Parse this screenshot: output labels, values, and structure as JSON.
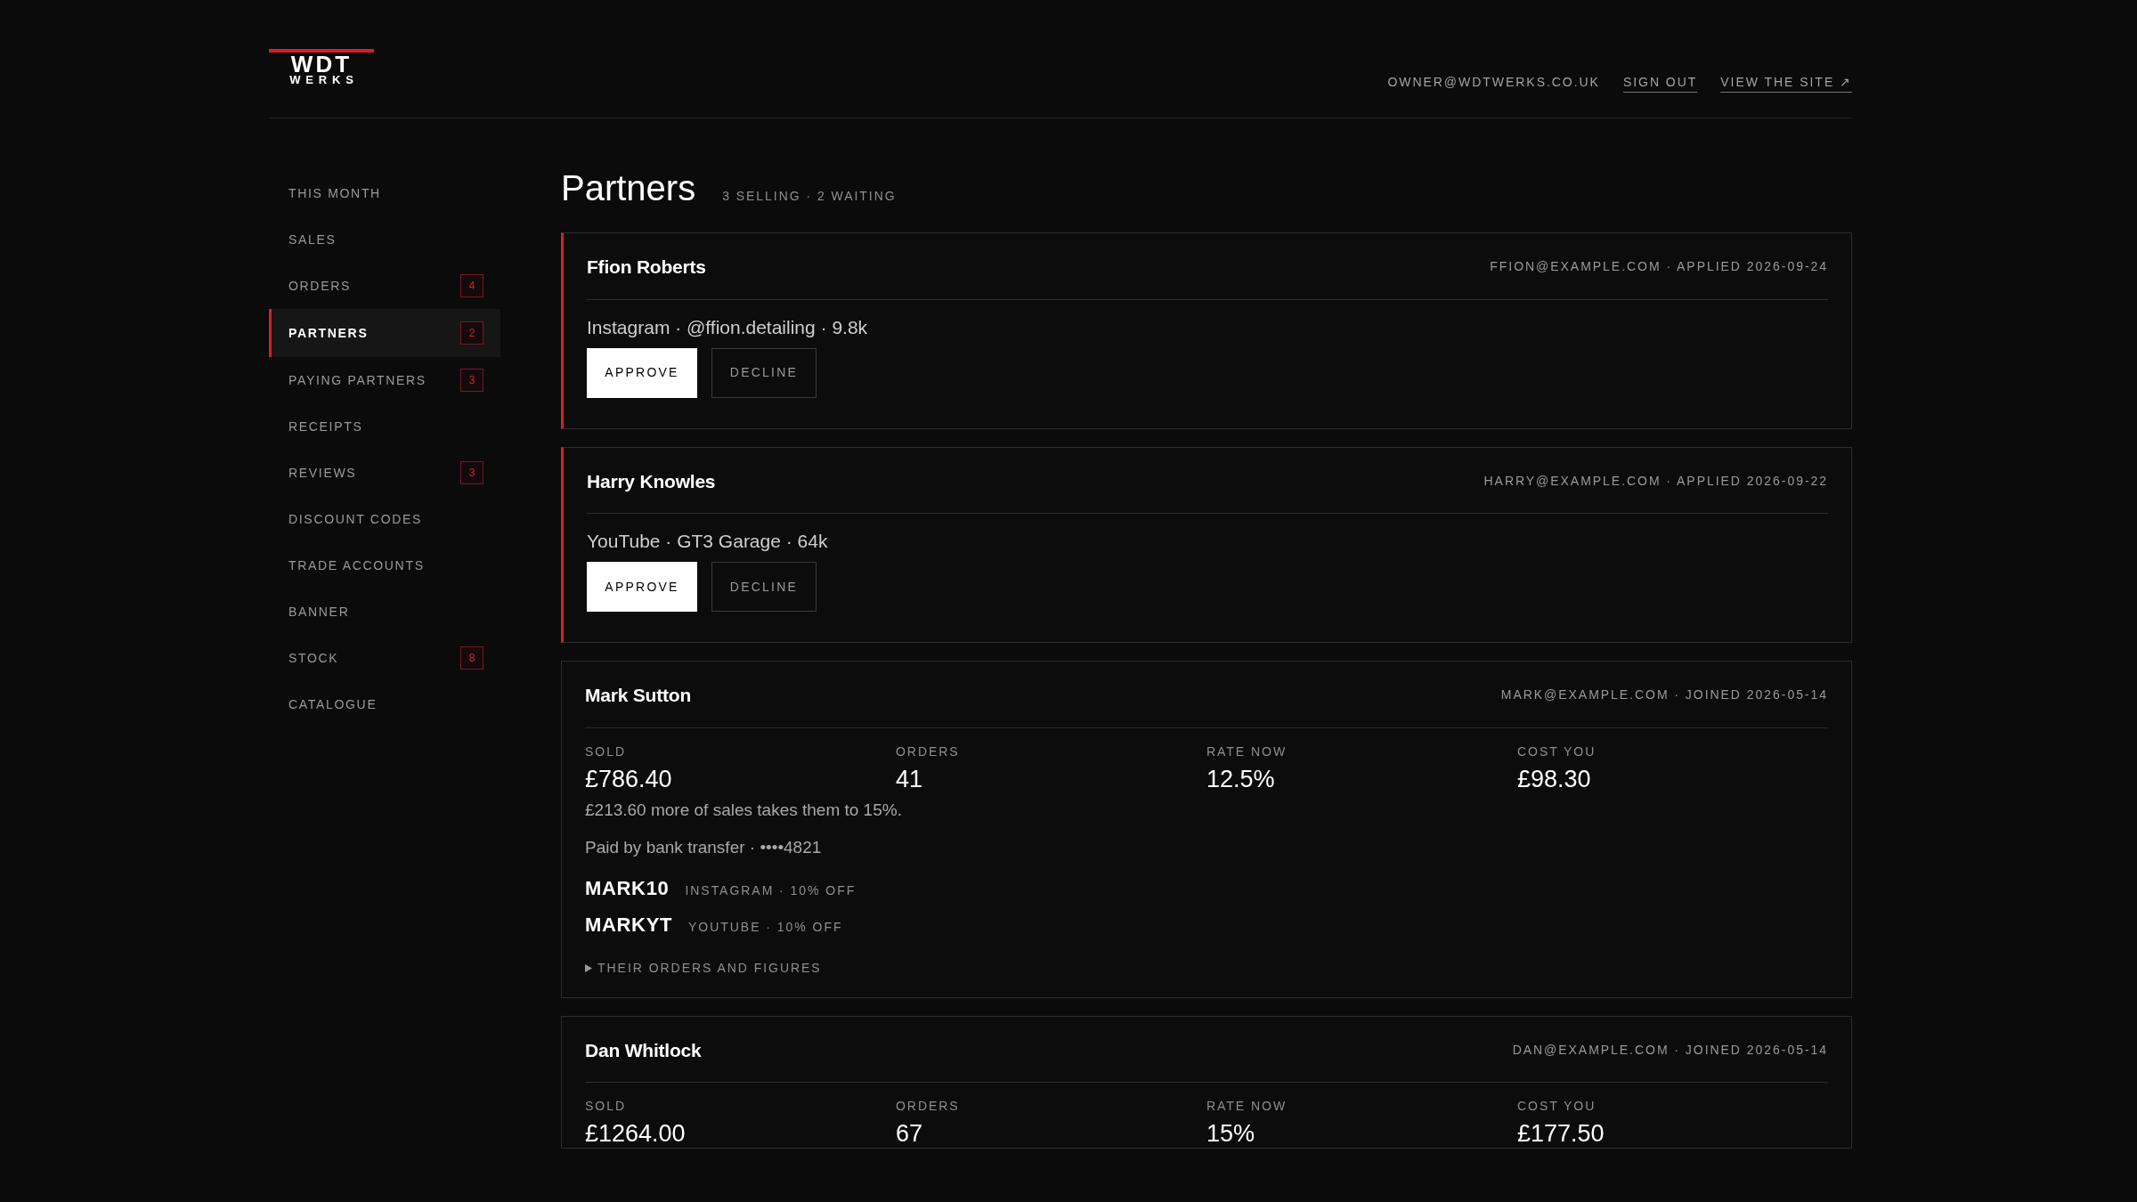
{
  "header": {
    "logo": {
      "top": "WDT",
      "bottom": "WERKS"
    },
    "account": "OWNER@WDTWERKS.CO.UK",
    "links": [
      {
        "label": "SIGN OUT"
      },
      {
        "label": "VIEW THE SITE ↗"
      }
    ]
  },
  "sidebar": {
    "items": [
      {
        "label": "THIS MONTH",
        "selected": false
      },
      {
        "label": "SALES",
        "selected": false
      },
      {
        "label": "ORDERS",
        "badge": "4",
        "selected": false
      },
      {
        "label": "PARTNERS",
        "badge": "2",
        "selected": true
      },
      {
        "label": "PAYING PARTNERS",
        "badge": "3",
        "selected": false
      },
      {
        "label": "RECEIPTS",
        "selected": false
      },
      {
        "label": "REVIEWS",
        "badge": "3",
        "selected": false
      },
      {
        "label": "DISCOUNT CODES",
        "selected": false
      },
      {
        "label": "TRADE ACCOUNTS",
        "selected": false
      },
      {
        "label": "BANNER",
        "selected": false
      },
      {
        "label": "STOCK",
        "badge": "8",
        "selected": false
      },
      {
        "label": "CATALOGUE",
        "selected": false
      }
    ]
  },
  "page": {
    "title": "Partners",
    "summary": "3 SELLING · 2 WAITING"
  },
  "partners": [
    {
      "kind": "applicant",
      "name": "Ffion Roberts",
      "meta": "FFION@EXAMPLE.COM · APPLIED 2026-09-24",
      "detail": "Instagram · @ffion.detailing · 9.8k",
      "buttons": [
        "APPROVE",
        "DECLINE"
      ]
    },
    {
      "kind": "applicant",
      "name": "Harry Knowles",
      "meta": "HARRY@EXAMPLE.COM · APPLIED 2026-09-22",
      "detail": "YouTube · GT3 Garage · 64k",
      "buttons": [
        "APPROVE",
        "DECLINE"
      ]
    },
    {
      "kind": "active",
      "name": "Mark Sutton",
      "meta": "MARK@EXAMPLE.COM · JOINED 2026-05-14",
      "stats": [
        {
          "label": "SOLD",
          "value": "£786.40"
        },
        {
          "label": "ORDERS",
          "value": "41"
        },
        {
          "label": "RATE NOW",
          "value": "12.5%"
        },
        {
          "label": "COST YOU",
          "value": "£98.30"
        }
      ],
      "note": "£213.60 more of sales takes them to 15%.",
      "payment": "Paid by bank transfer · ••••4821",
      "codes": [
        {
          "code": "MARK10",
          "detail": "INSTAGRAM · 10% OFF"
        },
        {
          "code": "MARKYT",
          "detail": "YOUTUBE · 10% OFF"
        }
      ],
      "disclosure": {
        "label": "THEIR ORDERS AND FIGURES",
        "expanded": false
      }
    },
    {
      "kind": "active",
      "name": "Dan Whitlock",
      "meta": "DAN@EXAMPLE.COM · JOINED 2026-05-14",
      "stats": [
        {
          "label": "SOLD",
          "value": "£1264.00"
        },
        {
          "label": "ORDERS",
          "value": "67"
        },
        {
          "label": "RATE NOW",
          "value": "15%"
        },
        {
          "label": "COST YOU",
          "value": "£177.50"
        }
      ]
    }
  ]
}
